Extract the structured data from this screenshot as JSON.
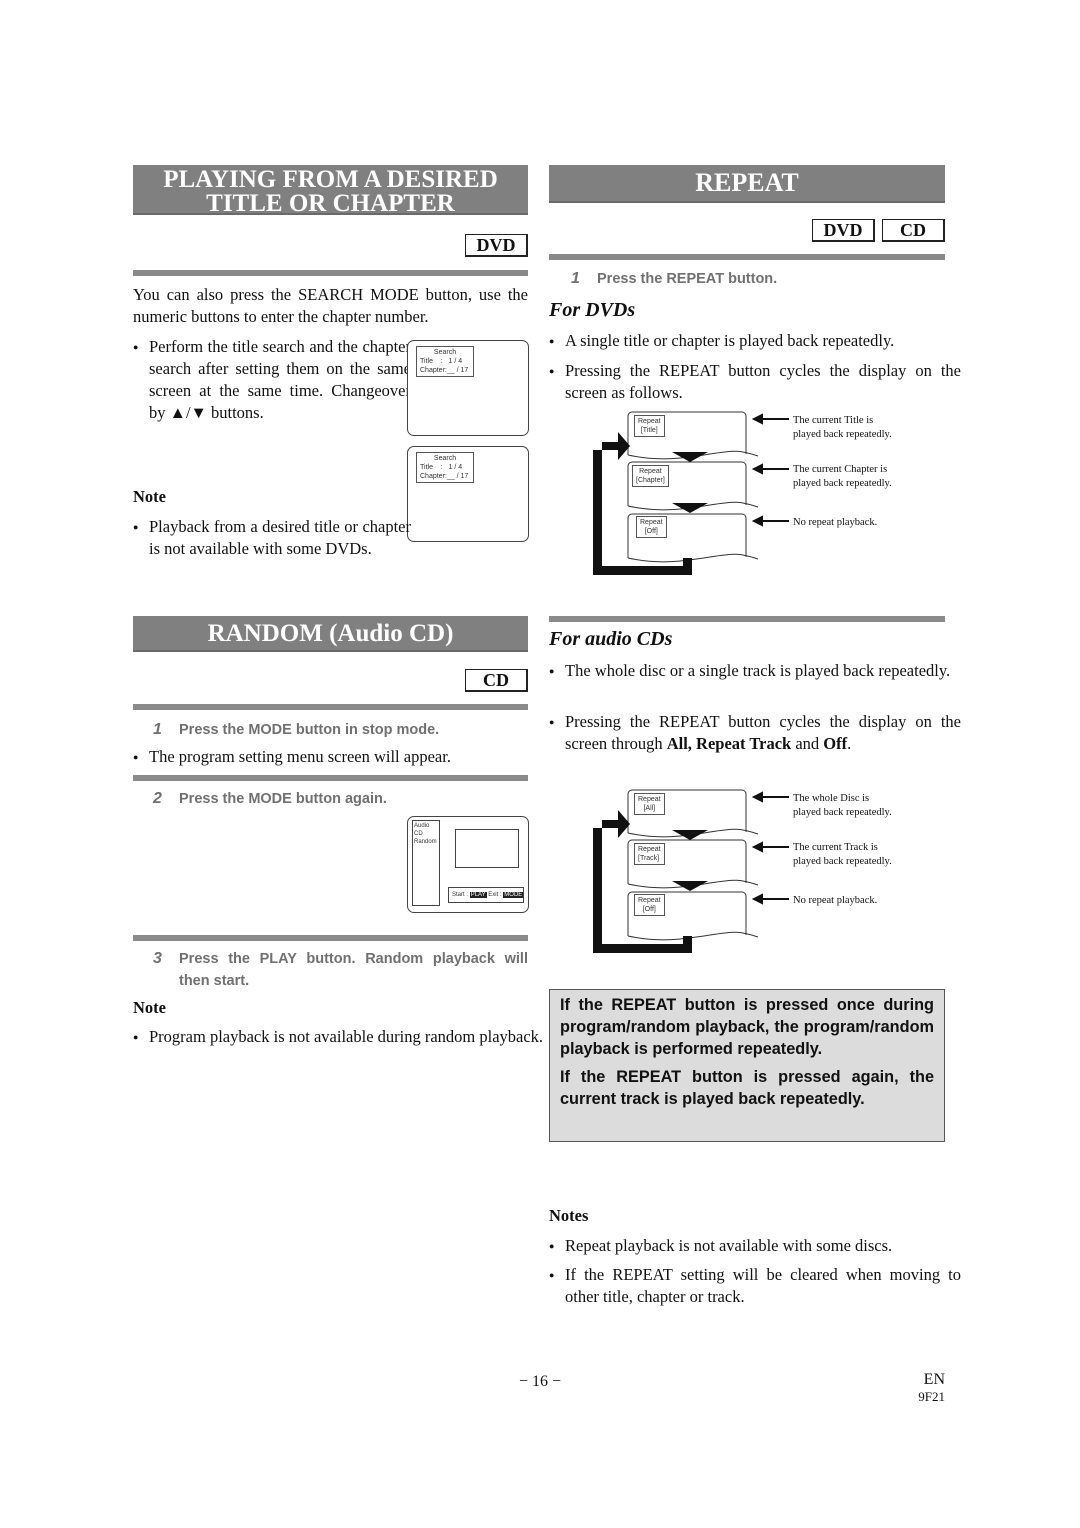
{
  "left": {
    "title_section": {
      "heading_line1": "PLAYING FROM A DESIRED",
      "heading_line2": "TITLE OR CHAPTER",
      "tag": "DVD",
      "intro": "You can also press the SEARCH MODE button, use the numeric buttons to enter the chapter number.",
      "bullet": "Perform the title search and the chapter search after setting them on the same screen at the same time. Changeover by ▲/▼ buttons.",
      "note_heading": "Note",
      "note_bullet": "Playback from a desired title or chapter is not available with some DVDs.",
      "screens": [
        {
          "label": "Search",
          "line1": "Title    :   1 / 4",
          "line2": "Chapter:__ / 17"
        },
        {
          "label": "Search",
          "line1": "Title    :   1 / 4",
          "line2": "Chapter:__ / 17"
        }
      ]
    },
    "random_section": {
      "heading": "RANDOM (Audio CD)",
      "tag": "CD",
      "step1_num": "1",
      "step1": "Press the MODE button in stop mode.",
      "step1_bullet": "The program setting menu screen will appear.",
      "step2_num": "2",
      "step2": "Press the MODE button again.",
      "screen": {
        "line1": "Audio CD",
        "line2": "Random",
        "start_label": "Start :",
        "start_key": "PLAY",
        "exit_label": "Exit :",
        "exit_key": "MODE"
      },
      "step3_num": "3",
      "step3": "Press the PLAY button. Random playback will then start.",
      "note_heading": "Note",
      "note_bullet": "Program playback is not available during random playback."
    }
  },
  "right": {
    "heading": "REPEAT",
    "tags": [
      "DVD",
      "CD"
    ],
    "step1_num": "1",
    "step1": "Press the REPEAT button.",
    "dvd": {
      "subheading": "For DVDs",
      "bullets": [
        "A single title or chapter is played back repeatedly.",
        "Pressing the REPEAT button cycles the display on the screen as follows."
      ],
      "diagram": [
        {
          "osd1": "Repeat",
          "osd2": "[Title]",
          "desc1": "The current Title is",
          "desc2": "played back repeatedly."
        },
        {
          "osd1": "Repeat",
          "osd2": "[Chapter]",
          "desc1": "The current Chapter is",
          "desc2": "played back repeatedly."
        },
        {
          "osd1": "Repeat",
          "osd2": "[Off]",
          "desc1": "No repeat playback.",
          "desc2": ""
        }
      ]
    },
    "cd": {
      "subheading": "For audio CDs",
      "bullet1": "The whole disc or a single track is played back repeatedly.",
      "bullet2_pre": "Pressing the REPEAT button cycles the display on the screen through ",
      "bullet2_bold1": "All, Repeat Track",
      "bullet2_mid": " and ",
      "bullet2_bold2": "Off",
      "bullet2_post": ".",
      "diagram": [
        {
          "osd1": "Repeat",
          "osd2": "[All]",
          "desc1": "The whole Disc is",
          "desc2": "played back repeatedly."
        },
        {
          "osd1": "Repeat",
          "osd2": "[Track]",
          "desc1": "The current Track is",
          "desc2": "played back repeatedly."
        },
        {
          "osd1": "Repeat",
          "osd2": "[Off]",
          "desc1": "No repeat playback.",
          "desc2": ""
        }
      ]
    },
    "highlight": {
      "para1": "If the REPEAT button is pressed once during program/random playback, the program/random playback is performed repeatedly.",
      "para2": "If the REPEAT button is pressed again, the current track is played back repeatedly."
    },
    "notes_heading": "Notes",
    "notes": [
      "Repeat playback is not available with some discs.",
      "If the REPEAT setting will be cleared when moving to other title, chapter or track."
    ]
  },
  "footer": {
    "page_number": "− 16 −",
    "lang": "EN",
    "code": "9F21"
  }
}
